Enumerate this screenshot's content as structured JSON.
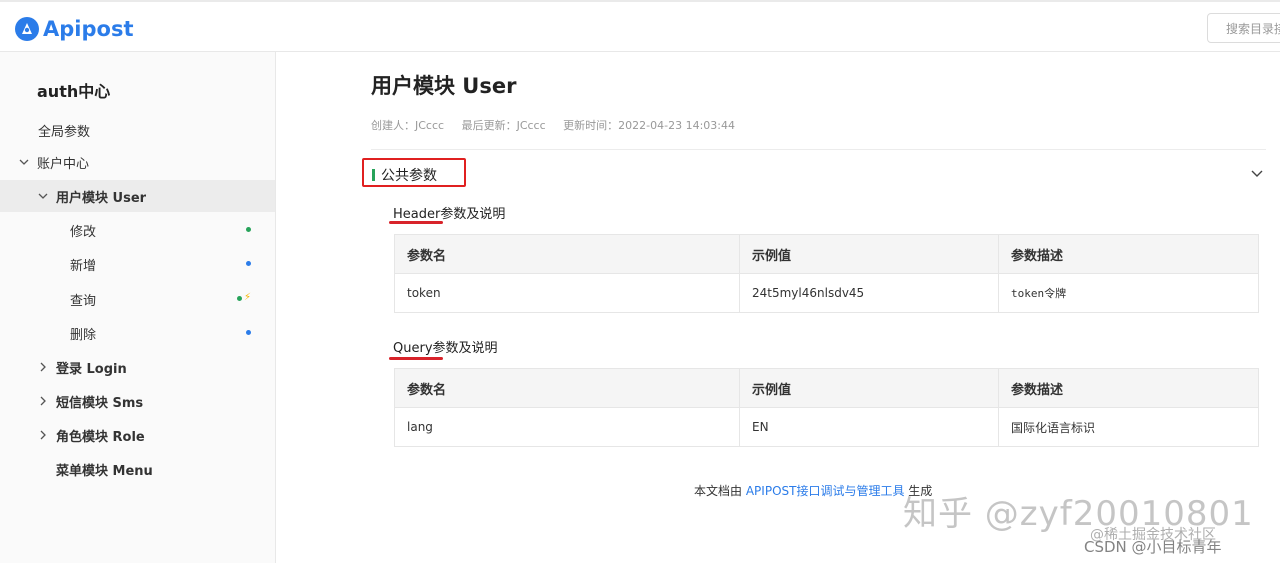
{
  "app": {
    "name": "Apipost"
  },
  "search": {
    "placeholder": "搜索目录接口"
  },
  "sidebar": {
    "title": "auth中心",
    "items": [
      {
        "label": "全局参数"
      },
      {
        "label": "账户中心"
      },
      {
        "label": "用户模块 User"
      },
      {
        "label": "修改"
      },
      {
        "label": "新增"
      },
      {
        "label": "查询"
      },
      {
        "label": "删除"
      },
      {
        "label": "登录 Login"
      },
      {
        "label": "短信模块 Sms"
      },
      {
        "label": "角色模块 Role"
      },
      {
        "label": "菜单模块 Menu"
      }
    ]
  },
  "doc": {
    "title": "用户模块 User",
    "creator": "创建人：JCccc",
    "updater": "最后更新：JCccc",
    "updated_time": "更新时间：2022-04-23 14:03:44"
  },
  "public_params": {
    "section_title": "公共参数",
    "header": {
      "title": "Header参数及说明",
      "columns": [
        "参数名",
        "示例值",
        "参数描述"
      ],
      "rows": [
        [
          "token",
          "24t5myl46nlsdv45",
          "token令牌"
        ]
      ]
    },
    "query": {
      "title": "Query参数及说明",
      "columns": [
        "参数名",
        "示例值",
        "参数描述"
      ],
      "rows": [
        [
          "lang",
          "EN",
          "国际化语言标识"
        ]
      ]
    }
  },
  "footer": {
    "prefix": "本文档由",
    "link": "APIPOST接口调试与管理工具",
    "suffix": "生成"
  },
  "watermarks": {
    "zhihu": "知乎 @zyf20010801",
    "juejin": "@稀土掘金技术社区",
    "csdn": "CSDN @小目标青年"
  },
  "colors": {
    "brand": "#2b7ce9",
    "highlight_red": "#e02020",
    "section_green": "#27a35a",
    "dot_green": "#27a35a",
    "dot_blue": "#2b7ce9",
    "bolt_yellow": "#f5b400"
  }
}
